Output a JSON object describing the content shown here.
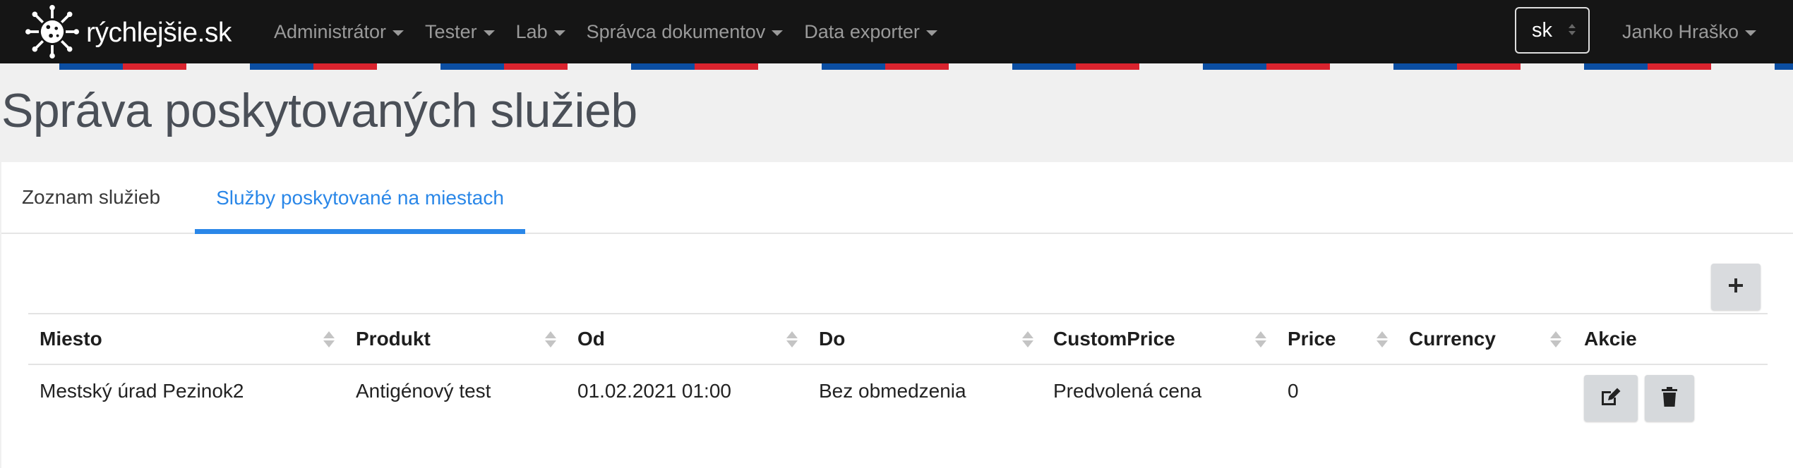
{
  "brand": {
    "name": "rýchlejšie.sk",
    "icon": "virus-logo-icon"
  },
  "nav": {
    "items": [
      {
        "label": "Administrátor"
      },
      {
        "label": "Tester"
      },
      {
        "label": "Lab"
      },
      {
        "label": "Správca dokumentov"
      },
      {
        "label": "Data exporter"
      }
    ],
    "language": "sk",
    "user": "Janko Hraško"
  },
  "colors": {
    "navbar": "#151515",
    "accent": "#2a87e8",
    "flag_blue": "#0b4ea2",
    "flag_red": "#d9232e"
  },
  "page": {
    "title": "Správa poskytovaných služieb"
  },
  "tabs": [
    {
      "label": "Zoznam služieb",
      "active": false
    },
    {
      "label": "Služby poskytované na miestach",
      "active": true
    }
  ],
  "toolbar": {
    "add_icon": "plus-icon"
  },
  "table": {
    "headers": [
      "Miesto",
      "Produkt",
      "Od",
      "Do",
      "CustomPrice",
      "Price",
      "Currency",
      "Akcie"
    ],
    "rows": [
      [
        "Mestský úrad Pezinok2",
        "Antigénový test",
        "01.02.2021 01:00",
        "Bez obmedzenia",
        "Predvolená cena",
        "0",
        ""
      ]
    ],
    "row_actions": [
      "edit-icon",
      "trash-icon"
    ]
  }
}
